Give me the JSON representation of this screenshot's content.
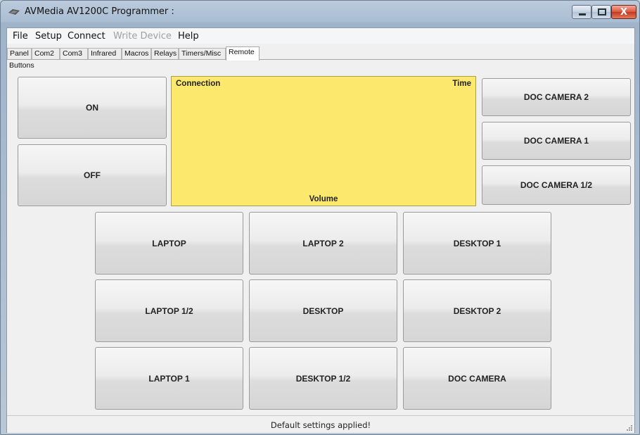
{
  "window": {
    "title": "AVMedia AV1200C Programmer :",
    "minimize_icon": "minimize-icon",
    "maximize_icon": "maximize-icon",
    "close_icon": "close-icon",
    "close_glyph": "X"
  },
  "menu": {
    "file": "File",
    "setup": "Setup",
    "connect": "Connect",
    "write_device": "Write Device",
    "help": "Help"
  },
  "tabs": [
    "Panel",
    "Com2",
    "Com3",
    "Infrared",
    "Macros",
    "Relays",
    "Timers/Misc",
    "Remote"
  ],
  "active_tab": "Remote",
  "remote": {
    "group_label": "Buttons",
    "on": "ON",
    "off": "OFF",
    "display": {
      "connection": "Connection",
      "time": "Time",
      "volume": "Volume",
      "background": "#fbe86c"
    },
    "doc_camera_2": "DOC CAMERA 2",
    "doc_camera_1": "DOC CAMERA 1",
    "doc_camera_1_2": "DOC CAMERA 1/2",
    "grid": [
      [
        "LAPTOP",
        "LAPTOP 2",
        "DESKTOP 1"
      ],
      [
        "LAPTOP 1/2",
        "DESKTOP",
        "DESKTOP 2"
      ],
      [
        "LAPTOP 1",
        "DESKTOP 1/2",
        "DOC CAMERA"
      ]
    ]
  },
  "status": {
    "text": "Default settings applied!"
  }
}
